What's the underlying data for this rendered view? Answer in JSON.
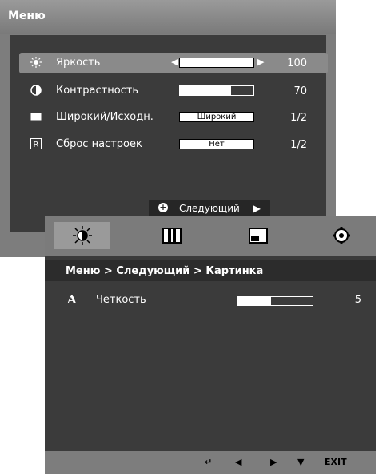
{
  "panel1": {
    "title": "Меню",
    "rows": [
      {
        "icon": "brightness-icon",
        "label": "Яркость",
        "value": "100",
        "fill": 1.0
      },
      {
        "icon": "contrast-icon",
        "label": "Контрастность",
        "value": "70",
        "fill": 0.7
      },
      {
        "icon": "wide-icon",
        "label": "Широкий/Исходн.",
        "value": "1/2",
        "option": "Широкий"
      },
      {
        "icon": "reset-icon",
        "label": "Сброс настроек",
        "value": "1/2",
        "option": "Нет"
      }
    ],
    "next_label": "Следующий"
  },
  "panel2": {
    "breadcrumb": "Меню > Следующий > Картинка",
    "sharpness": {
      "icon_text": "A",
      "label": "Четкость",
      "value": "5",
      "fill": 0.45
    },
    "bottom": {
      "exit_label": "EXIT"
    }
  }
}
